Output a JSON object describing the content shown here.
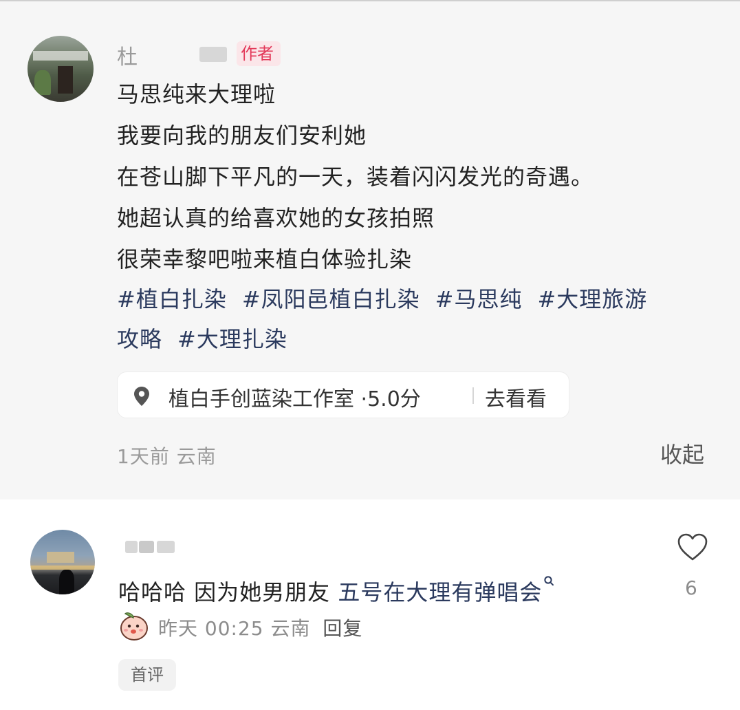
{
  "post": {
    "author_name": "杜",
    "author_badge": "作者",
    "content_lines": [
      "马思纯来大理啦",
      "我要向我的朋友们安利她",
      "在苍山脚下平凡的一天，装着闪闪发光的奇遇。",
      "她超认真的给喜欢她的女孩拍照",
      "很荣幸黎吧啦来植白体验扎染"
    ],
    "tags_line1": [
      "#植白扎染",
      "#凤阳邑植白扎染",
      "#马思纯",
      "#大理旅游"
    ],
    "tags_line2": [
      "攻略",
      "#大理扎染"
    ],
    "location": {
      "icon": "location-pin-icon",
      "name": "植白手创蓝染工作室 ·5.0分",
      "action": "去看看"
    },
    "time": "1天前",
    "region": "云南",
    "collapse_label": "收起"
  },
  "comment": {
    "text_plain": "哈哈哈 因为她男朋友 ",
    "text_link": "五号在大理有弹唱会",
    "time": "昨天 00:25",
    "region": "云南",
    "reply_label": "回复",
    "like_count": "6",
    "badge": "首评",
    "badge_icon": "peach-emoji-icon"
  },
  "colors": {
    "background": "#ffffff",
    "post_background": "#f6f6f6",
    "tag_link": "#2b3a5e",
    "author_badge_bg": "#fbe6e9",
    "author_badge_text": "#e33a5a",
    "meta_gray": "#9a9a9a"
  }
}
